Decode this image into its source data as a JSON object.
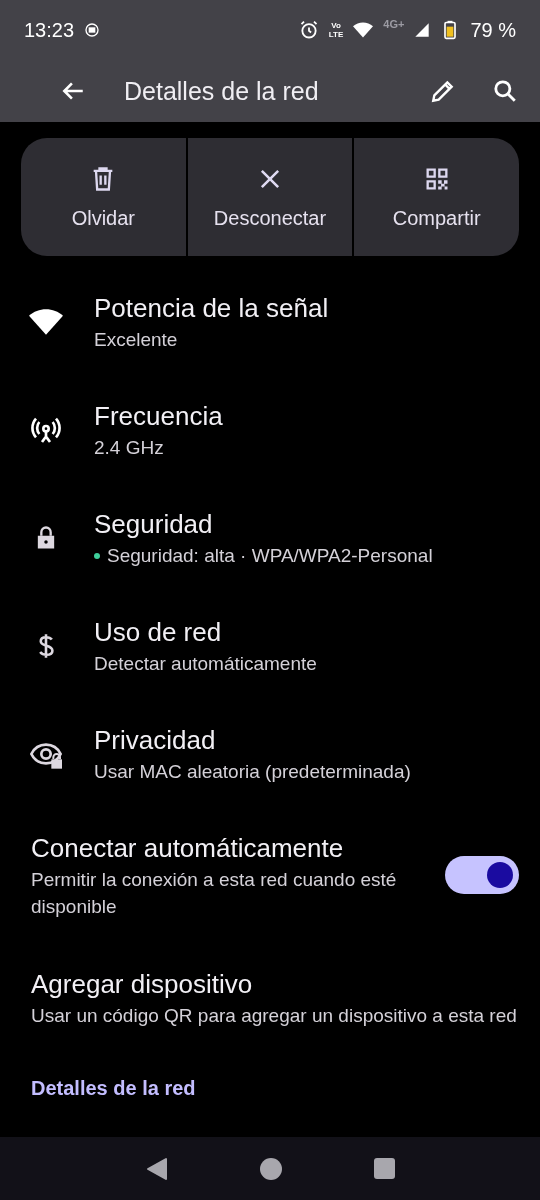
{
  "status_bar": {
    "time": "13:23",
    "volte_top": "Vo",
    "volte_bottom": "LTE",
    "network": "4G+",
    "battery": "79 %"
  },
  "app_bar": {
    "title": "Detalles de la red"
  },
  "actions": [
    {
      "label": "Olvidar"
    },
    {
      "label": "Desconectar"
    },
    {
      "label": "Compartir"
    }
  ],
  "details": [
    {
      "title": "Potencia de la señal",
      "subtitle": "Excelente"
    },
    {
      "title": "Frecuencia",
      "subtitle": "2.4 GHz"
    },
    {
      "title": "Seguridad",
      "subtitle": "Seguridad: alta · WPA/WPA2-Personal"
    },
    {
      "title": "Uso de red",
      "subtitle": "Detectar automáticamente"
    },
    {
      "title": "Privacidad",
      "subtitle": "Usar MAC aleatoria (predeterminada)"
    }
  ],
  "settings": [
    {
      "kind": "toggle",
      "title": "Conectar automáticamente",
      "subtitle": "Permitir la conexión a esta red cuando esté disponible",
      "checked": true
    },
    {
      "kind": "plain",
      "title": "Agregar dispositivo",
      "subtitle": "Usar un código QR para agregar un dispositivo a esta red"
    }
  ],
  "section_header": "Detalles de la red"
}
